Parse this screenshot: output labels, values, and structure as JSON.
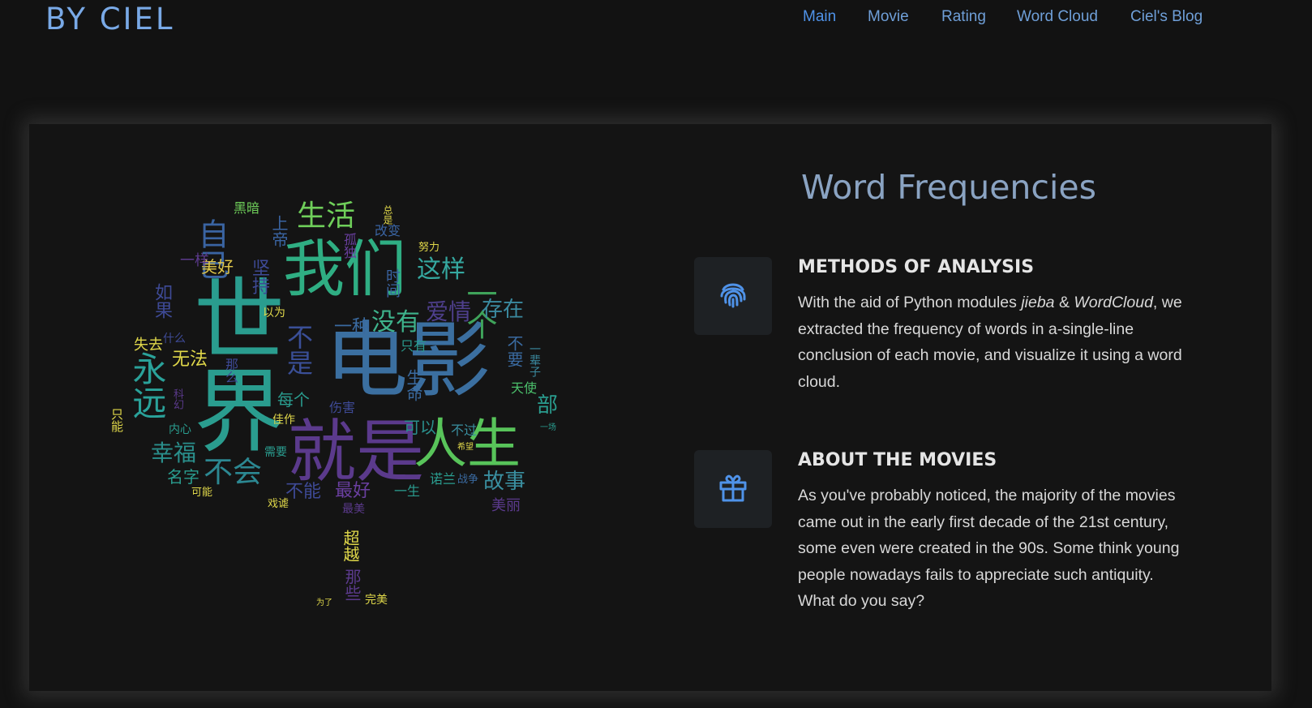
{
  "brand": "BY CIEL",
  "nav": {
    "items": [
      "Main",
      "Movie",
      "Rating",
      "Word Cloud",
      "Ciel's Blog"
    ],
    "active": "Main",
    "active_color": "#4f92e8",
    "color": "#6f9fd8"
  },
  "section": {
    "title": "Word Frequencies"
  },
  "features": [
    {
      "icon": "fingerprint-icon",
      "title": "METHODS OF ANALYSIS",
      "text_before": "With the aid of Python modules ",
      "em1": "jieba",
      "text_mid": " & ",
      "em2": "WordCloud",
      "text_after": ", we extracted the frequency of words in a-single-line conclusion of each movie, and visualize it using a word cloud."
    },
    {
      "icon": "gift-icon",
      "title": "ABOUT THE MOVIES",
      "text": "As you've probably noticed, the majority of the movies came out in the early first decade of the 21st century, some even were created in the 90s. Some think young people nowadays fails to appreciate such antiquity. What do you say?"
    }
  ],
  "word_cloud": {
    "words": [
      "世界",
      "电影",
      "我们",
      "就是",
      "人生",
      "永远",
      "生活",
      "自己",
      "这样",
      "一个",
      "没有",
      "爱情",
      "存在",
      "不是",
      "幸福",
      "不会",
      "故事",
      "最好",
      "不能",
      "一种",
      "黑暗",
      "上帝",
      "美好",
      "一样",
      "如果",
      "失去",
      "无法",
      "名字",
      "每个",
      "伤害",
      "可以",
      "不过",
      "只有",
      "生命",
      "天使",
      "一辈子",
      "不要",
      "部",
      "美丽",
      "最美",
      "超越",
      "那些",
      "完美",
      "诺兰",
      "战争",
      "改变",
      "孤独",
      "时间",
      "努力",
      "以为",
      "什么",
      "内心",
      "科幻",
      "需要",
      "可能",
      "佳作",
      "坚持",
      "那么",
      "一生",
      "只能",
      "戏谑",
      "为了",
      "一场",
      "希望",
      "总是"
    ],
    "palette": [
      "#2a9d8f",
      "#3b6fa0",
      "#5b3a8c",
      "#4bbf6b",
      "#9ad63a",
      "#e0d84a",
      "#23a7a0",
      "#3e4a96"
    ]
  }
}
